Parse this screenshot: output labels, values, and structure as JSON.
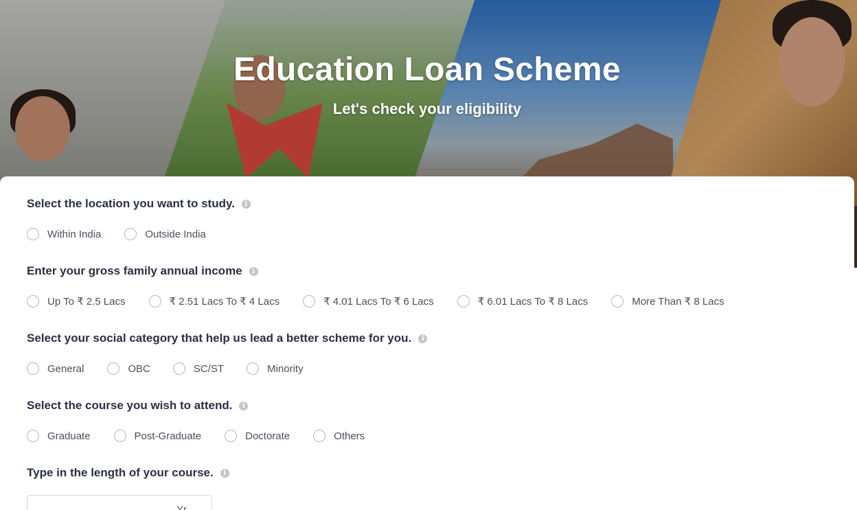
{
  "hero": {
    "title": "Education Loan Scheme",
    "subtitle": "Let's check your eligibility"
  },
  "form": {
    "location": {
      "question": "Select the location you want to study.",
      "options": [
        "Within India",
        "Outside India"
      ]
    },
    "income": {
      "question": "Enter your gross family annual income",
      "options": [
        "Up To ₹ 2.5 Lacs",
        "₹ 2.51 Lacs To ₹ 4 Lacs",
        "₹ 4.01 Lacs To ₹ 6 Lacs",
        "₹ 6.01 Lacs To ₹ 8 Lacs",
        "More Than ₹ 8 Lacs"
      ]
    },
    "category": {
      "question": "Select your social category that help us lead a better scheme for you.",
      "options": [
        "General",
        "OBC",
        "SC/ST",
        "Minority"
      ]
    },
    "course": {
      "question": "Select the course you wish to attend.",
      "options": [
        "Graduate",
        "Post-Graduate",
        "Doctorate",
        "Others"
      ]
    },
    "length": {
      "question": "Type in the length of your course.",
      "unit": "Yr"
    }
  },
  "icons": {
    "info": "info-icon",
    "radio": "radio-unchecked-icon"
  },
  "colors": {
    "text": "#2a2f45",
    "option_text": "#4a4f5e",
    "radio_border": "#b4b7bf",
    "info_icon": "#c3c5cc"
  }
}
